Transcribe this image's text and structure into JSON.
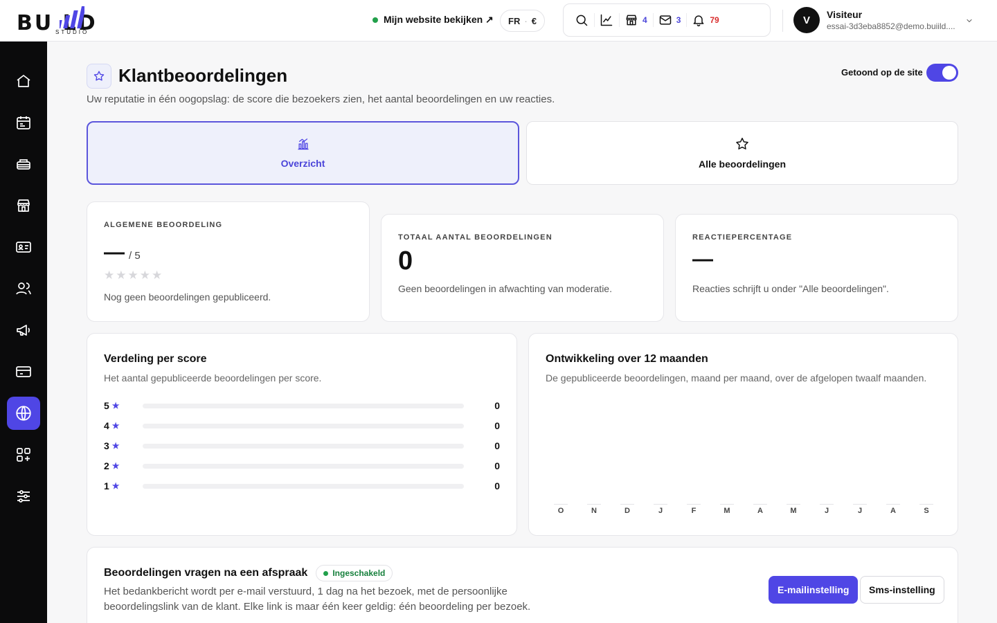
{
  "brand": {
    "logo_main": "BU  LD",
    "logo_sub": "STUDIO"
  },
  "topbar": {
    "site_link": "Mijn website bekijken ↗",
    "lang": "FR",
    "currency": "€",
    "counts": {
      "store": "4",
      "mail": "3",
      "notifications": "79"
    },
    "user": {
      "initial": "V",
      "name": "Visiteur",
      "email": "essai-3d3eba8852@demo.buiild...."
    }
  },
  "sidebar": {
    "items": [
      "home-icon",
      "calendar-icon",
      "service-icon",
      "store-icon",
      "contact-card-icon",
      "users-icon",
      "megaphone-icon",
      "payment-card-icon",
      "globe-icon",
      "apps-icon",
      "settings-sliders-icon"
    ],
    "active_index": 8
  },
  "page": {
    "title": "Klantbeoordelingen",
    "subtitle": "Uw reputatie in één oogopslag: de score die bezoekers zien, het aantal beoordelingen en uw reacties.",
    "toggle_label": "Getoond op de site",
    "toggle_on": true
  },
  "tabs": [
    {
      "label": "Overzicht",
      "active": true
    },
    {
      "label": "Alle beoordelingen",
      "active": false
    }
  ],
  "kpis": {
    "rating": {
      "label": "ALGEMENE BEOORDELING",
      "value": "—",
      "scale": "/ 5",
      "stars": "★★★★★",
      "note": "Nog geen beoordelingen gepubliceerd."
    },
    "total": {
      "label": "TOTAAL AANTAL BEOORDELINGEN",
      "value": "0",
      "note": "Geen beoordelingen in afwachting van moderatie."
    },
    "response": {
      "label": "REACTIEPERCENTAGE",
      "value": "—",
      "note": "Reacties schrijft u onder \"Alle beoordelingen\"."
    }
  },
  "distribution": {
    "title": "Verdeling per score",
    "subtitle": "Het aantal gepubliceerde beoordelingen per score.",
    "rows": [
      {
        "score": "5",
        "count": 0
      },
      {
        "score": "4",
        "count": 0
      },
      {
        "score": "3",
        "count": 0
      },
      {
        "score": "2",
        "count": 0
      },
      {
        "score": "1",
        "count": 0
      }
    ]
  },
  "evolution": {
    "title": "Ontwikkeling over 12 maanden",
    "subtitle": "De gepubliceerde beoordelingen, maand per maand, over de afgelopen twaalf maanden."
  },
  "chart_data": {
    "type": "bar",
    "categories": [
      "O",
      "N",
      "D",
      "J",
      "F",
      "M",
      "A",
      "M",
      "J",
      "J",
      "A",
      "S"
    ],
    "values": [
      0,
      0,
      0,
      0,
      0,
      0,
      0,
      0,
      0,
      0,
      0,
      0
    ],
    "title": "Ontwikkeling over 12 maanden",
    "xlabel": "",
    "ylabel": ""
  },
  "requests": {
    "title": "Beoordelingen vragen na een afspraak",
    "badge": "Ingeschakeld",
    "text_line1": "Het bedankbericht wordt per e-mail verstuurd, 1 dag na het bezoek, met de persoonlijke",
    "text_line2": "beoordelingslink van de klant. Elke link is maar één keer geldig: één beoordeling per bezoek.",
    "btn_email": "E-mailinstelling",
    "btn_sms": "Sms-instelling"
  },
  "colors": {
    "accent": "#4f46e5",
    "success": "#16803c",
    "danger": "#d92d2d",
    "sidebar_bg": "#0b0b0c"
  }
}
